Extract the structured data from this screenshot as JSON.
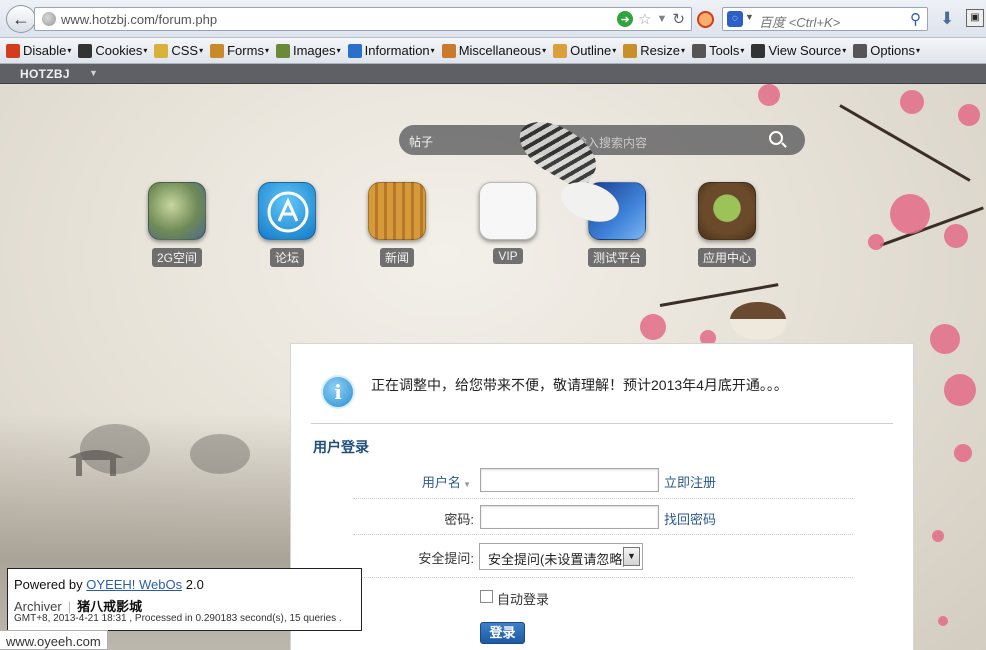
{
  "browser": {
    "url": "www.hotzbj.com/forum.php",
    "search_placeholder": "百度 <Ctrl+K>"
  },
  "devbar": {
    "items": [
      {
        "label": "Disable",
        "icon": "no-entry-icon",
        "color": "#d23d1e"
      },
      {
        "label": "Cookies",
        "icon": "person-icon",
        "color": "#333333"
      },
      {
        "label": "CSS",
        "icon": "pencil-icon",
        "color": "#d9b23c"
      },
      {
        "label": "Forms",
        "icon": "clipboard-icon",
        "color": "#c98a2a"
      },
      {
        "label": "Images",
        "icon": "picture-icon",
        "color": "#6a8a3a"
      },
      {
        "label": "Information",
        "icon": "info-icon",
        "color": "#2a6fc9"
      },
      {
        "label": "Miscellaneous",
        "icon": "notebook-icon",
        "color": "#c97a2a"
      },
      {
        "label": "Outline",
        "icon": "pencil-icon",
        "color": "#d9a03c"
      },
      {
        "label": "Resize",
        "icon": "ruler-icon",
        "color": "#c9902a"
      },
      {
        "label": "Tools",
        "icon": "tools-icon",
        "color": "#555555"
      },
      {
        "label": "View Source",
        "icon": "monitor-icon",
        "color": "#333333"
      },
      {
        "label": "Options",
        "icon": "options-icon",
        "color": "#555555"
      }
    ]
  },
  "site": {
    "name": "HOTZBJ"
  },
  "search_pill": {
    "label": "帖子",
    "placeholder": "请输入搜索内容"
  },
  "tiles": [
    {
      "label": "2G空间",
      "icon": "world-map-icon"
    },
    {
      "label": "论坛",
      "icon": "app-store-icon"
    },
    {
      "label": "新闻",
      "icon": "news-icon"
    },
    {
      "label": "VIP",
      "icon": "vip-icon"
    },
    {
      "label": "测试平台",
      "icon": "desktop-icon"
    },
    {
      "label": "应用中心",
      "icon": "app-center-icon"
    }
  ],
  "login": {
    "notice": "正在调整中，给您带来不便，敬请理解！预计2013年4月底开通。。。",
    "title": "用户登录",
    "username_label": "用户名",
    "register_link": "立即注册",
    "password_label": "密码:",
    "find_password_link": "找回密码",
    "question_label": "安全提问:",
    "question_selected": "安全提问(未设置请忽略)",
    "auto_login_label": "自动登录",
    "submit_label": "登录"
  },
  "footer": {
    "powered_prefix": "Powered by",
    "powered_link": "OYEEH! WebOs",
    "powered_version": "2.0",
    "archiver": "Archiver",
    "site_title": "猪八戒影城",
    "processed": "GMT+8, 2013-4-21 18:31 , Processed in 0.290183 second(s), 15 queries ."
  },
  "status_url": "www.oyeeh.com"
}
